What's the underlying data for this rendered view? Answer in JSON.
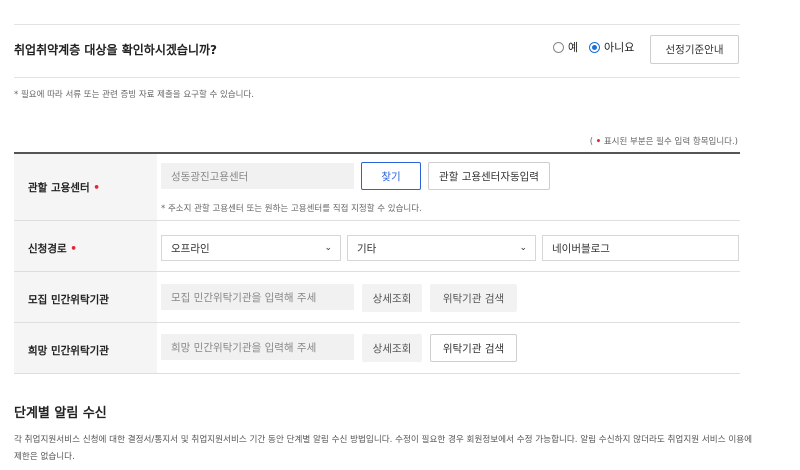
{
  "vulnerable": {
    "question": "취업취약계층 대상을 확인하시겠습니까?",
    "yes_label": "예",
    "no_label": "아니요",
    "selected": "아니요",
    "guide_button": "선정기준안내",
    "note": "* 필요에 따라 서류 또는 관련 증빙 자료 제출을 요구할 수 있습니다."
  },
  "required_note": {
    "open": "(",
    "text": "표시된 부분은 필수 입력 항목입니다.)"
  },
  "form": {
    "center": {
      "label": "관할 고용센터",
      "value": "성동광진고용센터",
      "find_button": "찾기",
      "auto_button": "관할 고용센터자동입력",
      "note": "* 주소지 관할 고용센터 또는 원하는 고용센터를 직접 지정할 수 있습니다."
    },
    "route": {
      "label": "신청경로",
      "select1": "오프라인",
      "select2": "기타",
      "input": "네이버블로그"
    },
    "recruit": {
      "label": "모집 민간위탁기관",
      "placeholder": "모집 민간위탁기관을 입력해 주세",
      "detail_button": "상세조회",
      "search_button": "위탁기관 검색"
    },
    "hope": {
      "label": "희망 민간위탁기관",
      "placeholder": "희망 민간위탁기관을 입력해 주세",
      "detail_button": "상세조회",
      "search_button": "위탁기관 검색"
    }
  },
  "alerts": {
    "title": "단계별 알림 수신",
    "desc": "각 취업지원서비스 신청에 대한 결정서/통지서 및 취업지원서비스 기간 동안 단계별 알림 수신 방법입니다. 수정이 필요한 경우 회원정보에서 수정 가능합니다. 알림 수신하지 않더라도 취업지원 서비스 이용에 제한은 없습니다."
  }
}
